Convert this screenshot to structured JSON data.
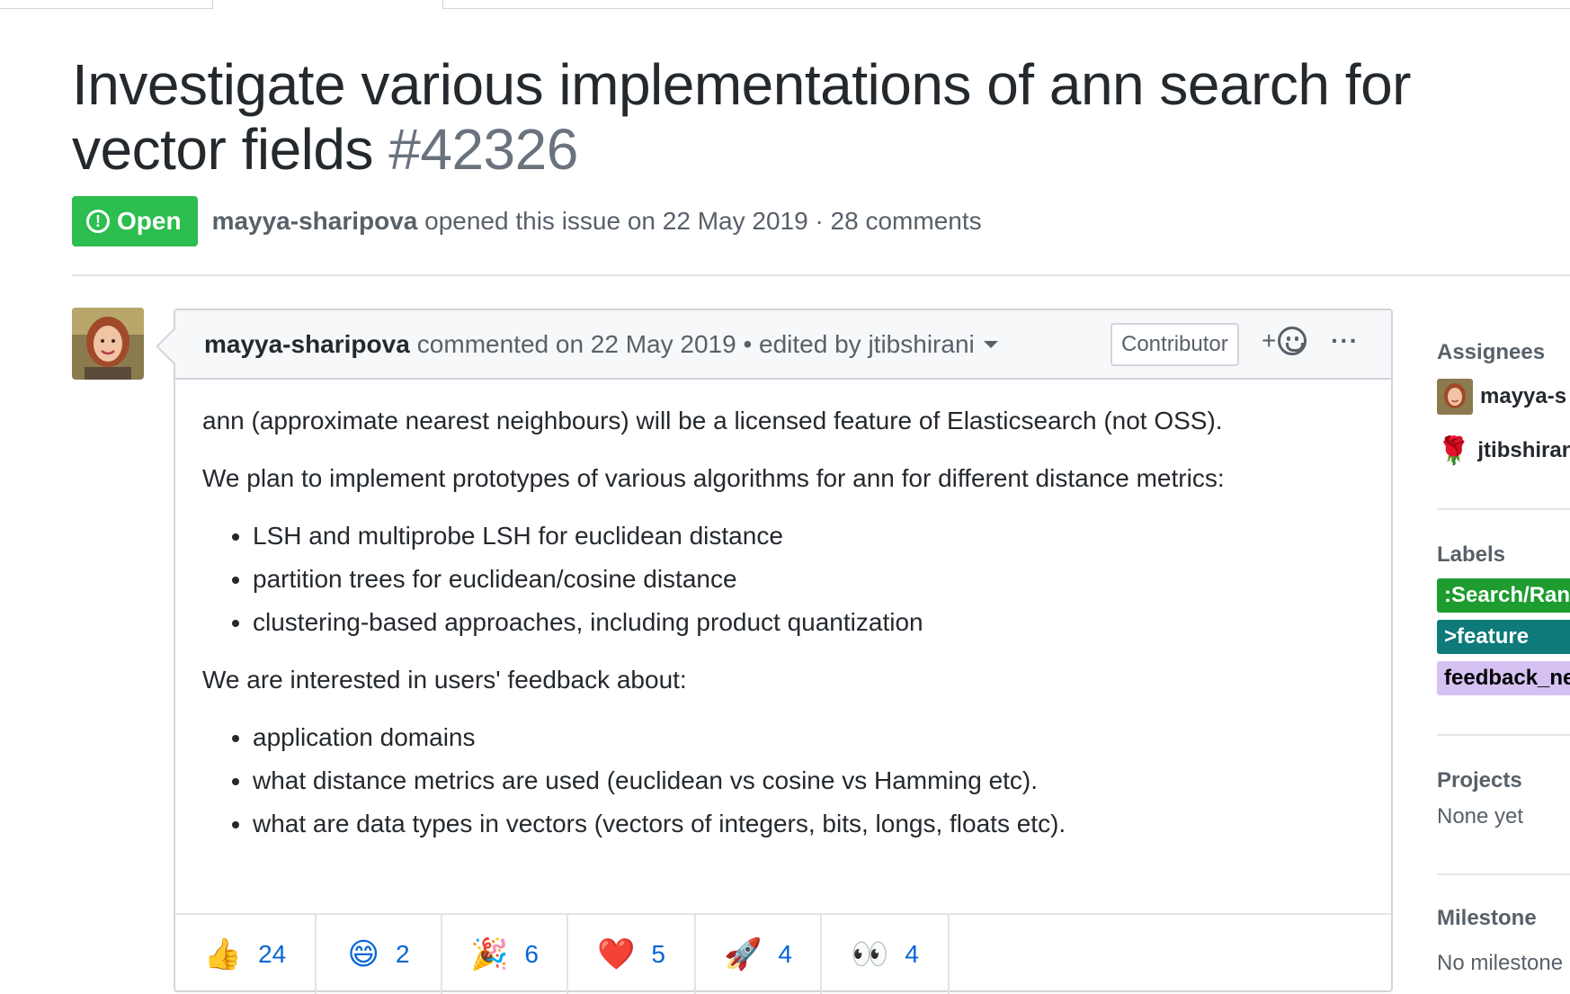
{
  "issue": {
    "title": "Investigate various implementations of ann search for vector fields",
    "number": "#42326",
    "state": "Open",
    "author": "mayya-sharipova",
    "opened_text": "opened this issue on 22 May 2019 · 28 comments"
  },
  "comment": {
    "author": "mayya-sharipova",
    "meta_text": "commented on 22 May 2019 • edited by jtibshirani",
    "role_badge": "Contributor",
    "react_plus": "+",
    "more": "···",
    "body": {
      "p1": "ann (approximate nearest neighbours) will be a licensed feature of Elasticsearch (not OSS).",
      "p2": "We plan to implement prototypes of various algorithms for ann for different distance metrics:",
      "list1": [
        "LSH and multiprobe LSH for euclidean distance",
        "partition trees for euclidean/cosine distance",
        "clustering-based approaches, including product quantization"
      ],
      "p3": "We are interested in users' feedback about:",
      "list2": [
        "application domains",
        "what distance metrics are used (euclidean vs cosine vs Hamming etc).",
        "what are data types in vectors (vectors of integers, bits, longs, floats etc)."
      ]
    },
    "reactions": [
      {
        "emoji": "👍",
        "count": "24"
      },
      {
        "emoji": "😄",
        "count": "2"
      },
      {
        "emoji": "🎉",
        "count": "6"
      },
      {
        "emoji": "❤️",
        "count": "5"
      },
      {
        "emoji": "🚀",
        "count": "4"
      },
      {
        "emoji": "👀",
        "count": "4"
      }
    ]
  },
  "sidebar": {
    "assignees_heading": "Assignees",
    "assignees": [
      "mayya-s",
      "jtibshirani"
    ],
    "labels_heading": "Labels",
    "labels": [
      {
        "text": ":Search/Ran",
        "bg": "#1d9c2f",
        "fg": "#ffffff"
      },
      {
        "text": ">feature",
        "bg": "#0e7a79",
        "fg": "#ffffff"
      },
      {
        "text": "feedback_ne",
        "bg": "#d6c2f2",
        "fg": "#000000"
      }
    ],
    "projects_heading": "Projects",
    "projects_value": "None yet",
    "milestone_heading": "Milestone",
    "milestone_value": "No milestone"
  },
  "colors": {
    "open_badge": "#2cbe4e",
    "link_blue": "#0366d6",
    "muted_text": "#586069"
  }
}
